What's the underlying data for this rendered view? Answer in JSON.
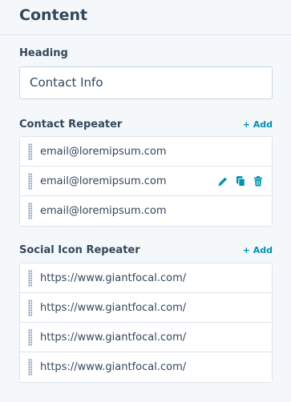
{
  "header": {
    "title": "Content"
  },
  "heading": {
    "label": "Heading",
    "value": "Contact Info"
  },
  "contact": {
    "label": "Contact Repeater",
    "add_label": "+ Add",
    "items": [
      {
        "text": "email@loremipsum.com"
      },
      {
        "text": "email@loremipsum.com"
      },
      {
        "text": "email@loremipsum.com"
      }
    ]
  },
  "social": {
    "label": "Social Icon Repeater",
    "add_label": "+ Add",
    "items": [
      {
        "text": "https://www.giantfocal.com/"
      },
      {
        "text": "https://www.giantfocal.com/"
      },
      {
        "text": "https://www.giantfocal.com/"
      },
      {
        "text": "https://www.giantfocal.com/"
      }
    ]
  },
  "row_actions": [
    "pencil-icon",
    "copy-icon",
    "trash-icon"
  ],
  "colors": {
    "accent": "#0091ae",
    "text": "#33475b",
    "border": "#cbd6e2",
    "background": "#f5f8fa"
  }
}
